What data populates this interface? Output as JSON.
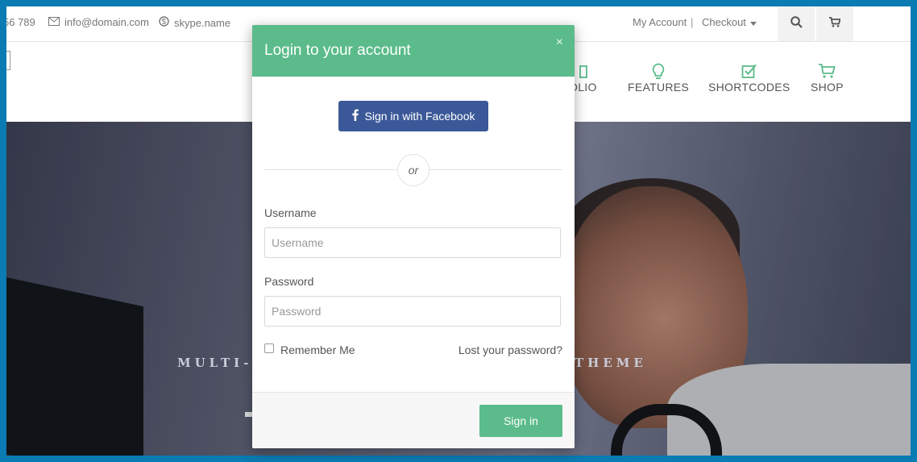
{
  "topbar": {
    "phone": "56 789",
    "email": "info@domain.com",
    "skype": "skype.name",
    "my_account": "My Account",
    "separator": "|",
    "checkout": "Checkout"
  },
  "nav": {
    "items": [
      {
        "label": "OLIO",
        "icon": "portfolio-icon"
      },
      {
        "label": "FEATURES",
        "icon": "lightbulb-icon"
      },
      {
        "label": "SHORTCODES",
        "icon": "checkbox-icon"
      },
      {
        "label": "SHOP",
        "icon": "cart-icon"
      }
    ]
  },
  "hero": {
    "text_left": "MULTI-P",
    "text_right": "THEME"
  },
  "modal": {
    "title": "Login to your account",
    "close": "×",
    "facebook_label": "Sign in with Facebook",
    "or_label": "or",
    "username_label": "Username",
    "username_placeholder": "Username",
    "username_value": "",
    "password_label": "Password",
    "password_placeholder": "Password",
    "password_value": "",
    "remember_label": "Remember Me",
    "remember_checked": false,
    "lost_password": "Lost your password?",
    "signin_label": "Sign in"
  },
  "colors": {
    "accent": "#5bbb8a",
    "facebook": "#3b5998",
    "frame": "#0a7bb3"
  }
}
